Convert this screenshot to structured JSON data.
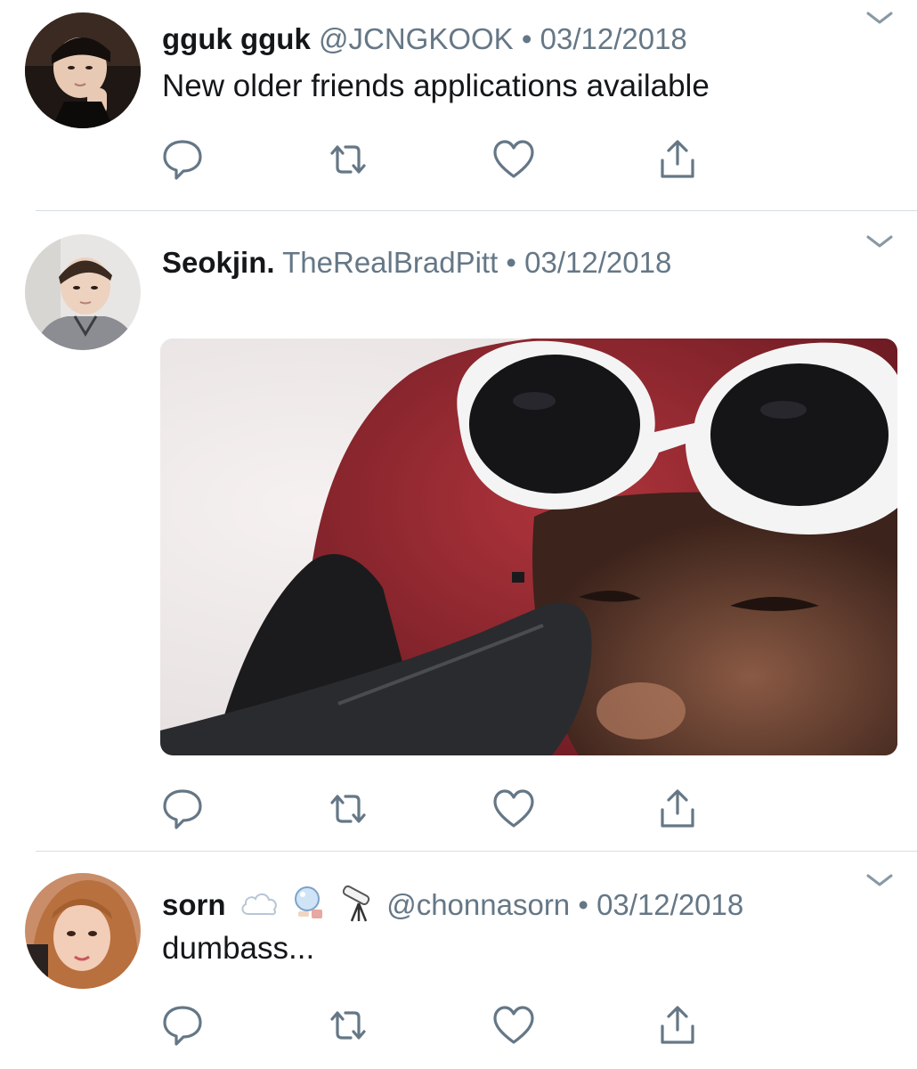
{
  "tweets": [
    {
      "display_name": "gguk gguk",
      "handle": "@JCNGKOOK",
      "separator": "•",
      "date": "03/12/2018",
      "text": "New older friends applications available"
    },
    {
      "display_name": "Seokjin.",
      "handle": "TheRealBradPitt",
      "separator": "•",
      "date": "03/12/2018",
      "text": ""
    },
    {
      "display_name": "sorn",
      "name_emojis": [
        "cloud-emoji",
        "crystal-ball-emoji",
        "telescope-emoji"
      ],
      "handle": "@chonnasorn",
      "separator": "•",
      "date": "03/12/2018",
      "text": "dumbass..."
    }
  ],
  "icons": {
    "reply": "speech-bubble-icon",
    "retweet": "retweet-arrows-icon",
    "like": "heart-icon",
    "share": "share-upload-icon",
    "menu": "chevron-down-icon"
  },
  "colors": {
    "name": "#14171a",
    "meta": "#657786",
    "icon": "#657786",
    "divider": "#d6dde3"
  }
}
